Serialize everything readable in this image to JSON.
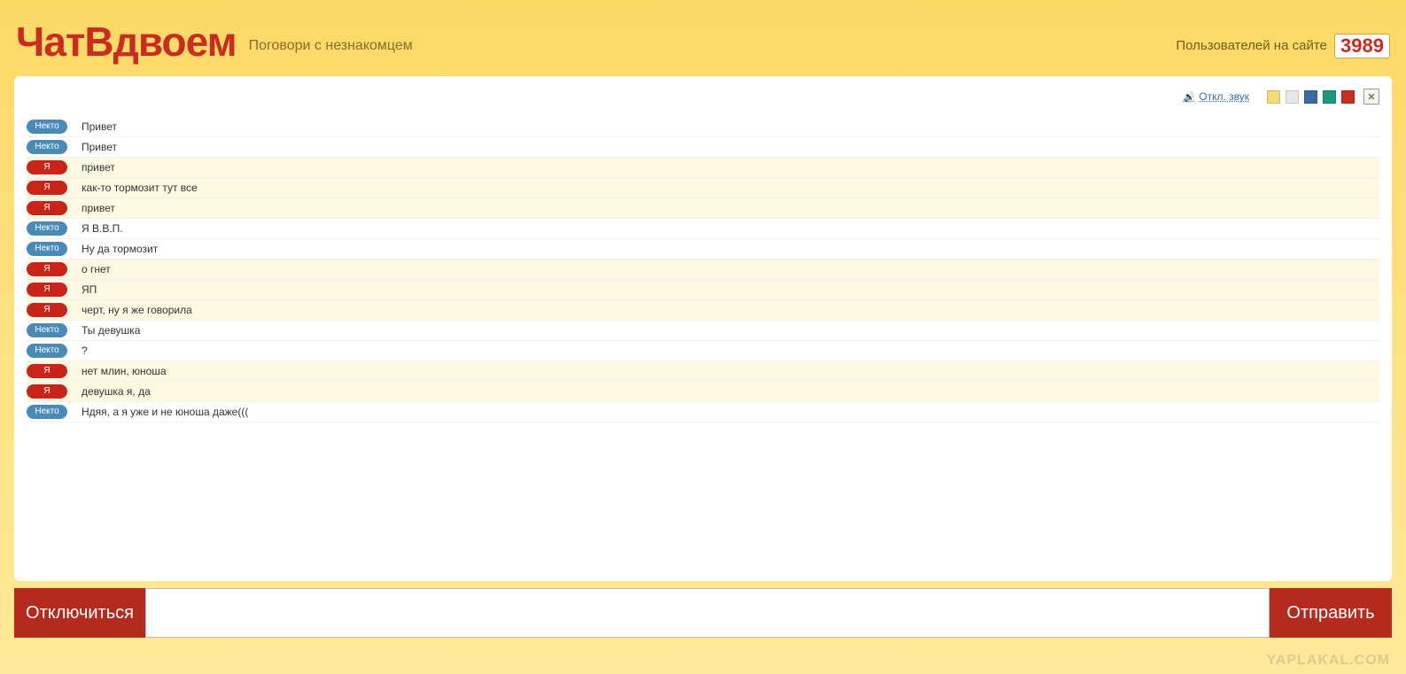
{
  "header": {
    "logo": "ЧатВдвоем",
    "tagline": "Поговори с незнакомцем",
    "users_label": "Пользователей на сайте",
    "users_count": "3989"
  },
  "controls": {
    "sound_label": "Откл. звук",
    "swatches": [
      "#f4da7a",
      "#e8e8e8",
      "#3a6aa5",
      "#1a9a7a",
      "#c82e1f"
    ]
  },
  "labels": {
    "nekto": "Некто",
    "me": "Я"
  },
  "messages": [
    {
      "who": "nekto",
      "text": "Привет"
    },
    {
      "who": "nekto",
      "text": "Привет"
    },
    {
      "who": "me",
      "text": "привет"
    },
    {
      "who": "me",
      "text": "как-то тормозит тут все"
    },
    {
      "who": "me",
      "text": "привет"
    },
    {
      "who": "nekto",
      "text": "Я В.В.П."
    },
    {
      "who": "nekto",
      "text": "Ну да тормозит"
    },
    {
      "who": "me",
      "text": "о гнет"
    },
    {
      "who": "me",
      "text": "ЯП"
    },
    {
      "who": "me",
      "text": "черт, ну я же говорила"
    },
    {
      "who": "nekto",
      "text": "Ты девушка"
    },
    {
      "who": "nekto",
      "text": "?"
    },
    {
      "who": "me",
      "text": "нет млин, юноша"
    },
    {
      "who": "me",
      "text": "девушка я, да"
    },
    {
      "who": "nekto",
      "text": "Ндяя, а я уже и не юноша даже((("
    }
  ],
  "input": {
    "value": ""
  },
  "buttons": {
    "disconnect": "Отключиться",
    "send": "Отправить"
  },
  "watermark": "YAPLAKAL.COM"
}
